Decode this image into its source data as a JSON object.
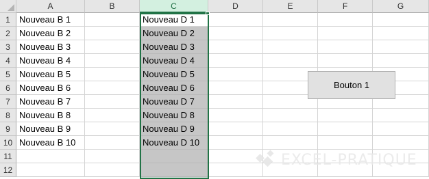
{
  "columns": [
    "A",
    "B",
    "C",
    "D",
    "E",
    "F",
    "G"
  ],
  "selected_column": "C",
  "rows": [
    "1",
    "2",
    "3",
    "4",
    "5",
    "6",
    "7",
    "8",
    "9",
    "10",
    "11",
    "12"
  ],
  "cells": {
    "A": [
      "Nouveau B 1",
      "Nouveau B 2",
      "Nouveau B 3",
      "Nouveau B 4",
      "Nouveau B 5",
      "Nouveau B 6",
      "Nouveau B 7",
      "Nouveau B 8",
      "Nouveau B 9",
      "Nouveau B 10",
      "",
      ""
    ],
    "C": [
      "Nouveau D 1",
      "Nouveau D 2",
      "Nouveau D 3",
      "Nouveau D 4",
      "Nouveau D 5",
      "Nouveau D 6",
      "Nouveau D 7",
      "Nouveau D 8",
      "Nouveau D 9",
      "Nouveau D 10",
      "",
      ""
    ]
  },
  "button": {
    "label": "Bouton 1"
  },
  "watermark": {
    "text": "EXCEL-PRATIQUE"
  },
  "colors": {
    "selection_accent": "#217346",
    "selection_fill": "#c6c6c6"
  }
}
